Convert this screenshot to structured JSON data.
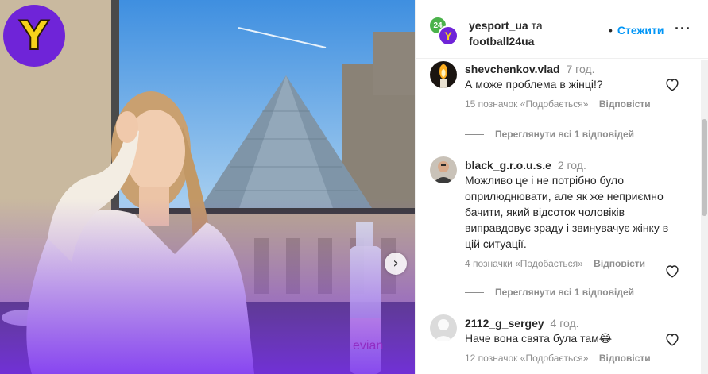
{
  "brand": {
    "logo_letter": "Y",
    "logo_color": "#6f24d8",
    "logo_letter_color": "#f7d21a"
  },
  "carousel": {
    "next_icon": "chevron-right-icon",
    "next_glyph": "›"
  },
  "post_header": {
    "owner_1": "yesport_ua",
    "conjunction": "та",
    "owner_2": "football24ua",
    "dot": "•",
    "follow_label": "Стежити",
    "more_label": "···",
    "avatar_back_text": "24",
    "avatar_front_text": "Y"
  },
  "comments": [
    {
      "user": "shevchenkov.vlad",
      "time": "7 год.",
      "text": "А може проблема в жінці!?",
      "likes": "15 позначок «Подобається»",
      "reply": "Відповісти",
      "view_replies": "Переглянути всі 1 відповідей"
    },
    {
      "user": "black_g.r.o.u.s.e",
      "time": "2 год.",
      "text": "Можливо це і не потрібно було оприлюднювати, але як же неприємно бачити, який відсоток чоловіків виправдовує зраду і звинувачує жінку в цій ситуації.",
      "likes": "4 позначки «Подобається»",
      "reply": "Відповісти",
      "view_replies": "Переглянути всі 1 відповідей"
    },
    {
      "user": "2112_g_sergey",
      "time": "4 год.",
      "text": "Наче вона свята була там😂",
      "likes": "12 позначок «Подобається»",
      "reply": "Відповісти"
    }
  ],
  "colors": {
    "accent": "#0095f6",
    "muted": "#8e8e8e",
    "text": "#262626"
  }
}
